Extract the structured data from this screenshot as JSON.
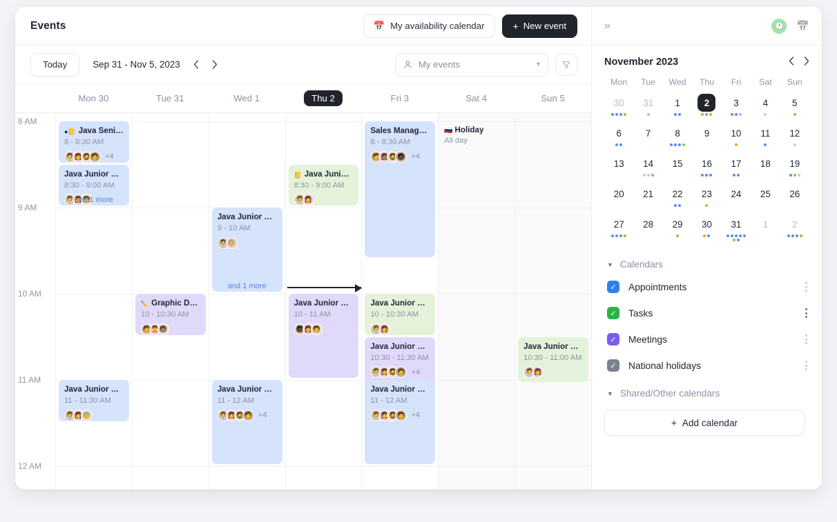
{
  "header": {
    "title": "Events",
    "availability_button": "My availability calendar",
    "availability_icon": "calendar-pencil-icon",
    "new_event_button": "New event",
    "new_event_plus": "+"
  },
  "toolbar": {
    "today_button": "Today",
    "range_label": "Sep 31 -  Nov 5, 2023",
    "prev_icon": "chevron-left-icon",
    "next_icon": "chevron-right-icon",
    "events_filter": "My events",
    "events_filter_icon": "person-icon",
    "caret_icon": "chevron-down-icon",
    "filter_icon": "funnel-icon"
  },
  "calendar": {
    "day_headers": [
      {
        "label": "Mon 30",
        "today": false,
        "weekend": false
      },
      {
        "label": "Tue 31",
        "today": false,
        "weekend": false
      },
      {
        "label": "Wed 1",
        "today": false,
        "weekend": false
      },
      {
        "label": "Thu 2",
        "today": true,
        "weekend": false
      },
      {
        "label": "Fri 3",
        "today": false,
        "weekend": false
      },
      {
        "label": "Sat 4",
        "today": false,
        "weekend": true
      },
      {
        "label": "Sun 5",
        "today": false,
        "weekend": true
      }
    ],
    "hours": [
      "8 AM",
      "9 AM",
      "10 AM",
      "11 AM",
      "12 AM"
    ],
    "more_label": "and 1 more",
    "events": [
      {
        "day": 0,
        "title": "Java Senio...",
        "time": "8 - 8:30 AM",
        "color": "blue",
        "start": 8.0,
        "end": 8.5,
        "avatars": [
          "🧑‍💼",
          "👩",
          "🧔",
          "🧑"
        ],
        "overflow": "+4",
        "badges": [
          "●",
          "📒"
        ],
        "more": false
      },
      {
        "day": 0,
        "title": "Java Junior dev...",
        "time": "8:30 - 9:00 AM",
        "color": "blue",
        "start": 8.5,
        "end": 9.0,
        "avatars": [
          "🧑‍💼",
          "👩",
          "🧑"
        ],
        "overflow": "",
        "badges": [],
        "more": true
      },
      {
        "day": 2,
        "title": "Java Junior dev...",
        "time": "9 - 10 AM",
        "color": "blue",
        "start": 9.0,
        "end": 10.0,
        "avatars": [
          "🧑‍💼",
          "🧓"
        ],
        "overflow": "",
        "badges": [],
        "more": true
      },
      {
        "day": 3,
        "title": "Java Junior d...",
        "time": "8:30 - 9:00 AM",
        "color": "green",
        "start": 8.5,
        "end": 9.0,
        "avatars": [
          "🧑‍💼",
          "👩"
        ],
        "overflow": "",
        "badges": [
          "📒"
        ],
        "more": false
      },
      {
        "day": 4,
        "title": "Sales Manager - Tatiana Patris",
        "time": "8 - 8:30 AM",
        "color": "blue",
        "start": 8.0,
        "end": 9.6,
        "avatars": [
          "🧑",
          "👩🏽",
          "🧔",
          "🧑🏿"
        ],
        "overflow": "+4",
        "badges": [],
        "more": false
      },
      {
        "day": 1,
        "title": "Graphic Des...",
        "time": "10 - 10:30 AM",
        "color": "lilac",
        "start": 10.0,
        "end": 10.5,
        "avatars": [
          "🧑",
          "🧑‍🦱",
          "🧑🏽"
        ],
        "overflow": "",
        "badges": [
          "✏️"
        ],
        "more": false
      },
      {
        "day": 3,
        "title": "Java Junior dev...",
        "time": "10 - 11 AM",
        "color": "lilac",
        "start": 10.0,
        "end": 11.0,
        "avatars": [
          "🧑🏿",
          "👩",
          "🧑"
        ],
        "overflow": "",
        "badges": [],
        "more": false
      },
      {
        "day": 4,
        "title": "Java Junior dev...",
        "time": "10 - 10:30 AM",
        "color": "green",
        "start": 10.0,
        "end": 10.5,
        "avatars": [
          "🧑‍💼",
          "👩"
        ],
        "overflow": "",
        "badges": [],
        "more": false
      },
      {
        "day": 4,
        "title": "Java Junior dev...",
        "time": "10:30 - 11:30 AM",
        "color": "lilac",
        "start": 10.5,
        "end": 11.5,
        "avatars": [
          "🧑‍💼",
          "👩",
          "🧔",
          "🧑"
        ],
        "overflow": "+4",
        "badges": [],
        "more": false
      },
      {
        "day": 6,
        "title": "Java Junior dev...",
        "time": "10:30 - 11:00 AM",
        "color": "green",
        "start": 10.5,
        "end": 11.05,
        "avatars": [
          "🧑‍💼",
          "👩"
        ],
        "overflow": "",
        "badges": [],
        "more": false
      },
      {
        "day": 0,
        "title": "Java Junior dev...",
        "time": "11 - 11:30 AM",
        "color": "blue",
        "start": 11.0,
        "end": 11.5,
        "avatars": [
          "🧑‍💼",
          "👩",
          "🧓"
        ],
        "overflow": "",
        "badges": [],
        "more": false
      },
      {
        "day": 2,
        "title": "Java Junior dev...",
        "time": "11 - 12 AM",
        "color": "blue",
        "start": 11.0,
        "end": 12.0,
        "avatars": [
          "🧑‍💼",
          "👩",
          "🧔",
          "🧑"
        ],
        "overflow": "+4",
        "badges": [],
        "more": false
      },
      {
        "day": 4,
        "title": "Java Junior dev...",
        "time": "11 - 12 AM",
        "color": "blue",
        "start": 11.0,
        "end": 12.0,
        "avatars": [
          "🧑‍💼",
          "👩",
          "🧔",
          "🧑"
        ],
        "overflow": "+4",
        "badges": [],
        "more": false
      }
    ],
    "allday": [
      {
        "day": 5,
        "title": "Holiday",
        "time": "All day",
        "flag": "🇷🇺"
      }
    ]
  },
  "sidebar": {
    "collapse_icon": "chevron-double-right-icon",
    "clock_icon": "clock-icon",
    "calendar_icon": "calendar-icon",
    "mini": {
      "title": "November 2023",
      "prev_icon": "chevron-left-icon",
      "next_icon": "chevron-right-icon",
      "dow": [
        "Mon",
        "Tue",
        "Wed",
        "Thu",
        "Fri",
        "Sat",
        "Sun"
      ],
      "days": [
        {
          "n": "30",
          "muted": true,
          "sel": false,
          "dots": [
            "#5b8def",
            "#5b8def",
            "#5b8def",
            "#8bc34a"
          ]
        },
        {
          "n": "31",
          "muted": true,
          "sel": false,
          "dots": [
            "#aab6f5"
          ]
        },
        {
          "n": "1",
          "muted": false,
          "sel": false,
          "dots": [
            "#5b8def",
            "#5b8def"
          ]
        },
        {
          "n": "2",
          "muted": false,
          "sel": true,
          "dots": [
            "#8bc34a",
            "#9e9e9e",
            "#f5a623"
          ]
        },
        {
          "n": "3",
          "muted": false,
          "sel": false,
          "dots": [
            "#5b8def",
            "#5b8def",
            "#aab6f5"
          ]
        },
        {
          "n": "4",
          "muted": false,
          "sel": false,
          "dots": [
            "#c9ccd6"
          ]
        },
        {
          "n": "5",
          "muted": false,
          "sel": false,
          "dots": [
            "#8bc34a"
          ]
        },
        {
          "n": "6",
          "muted": false,
          "sel": false,
          "dots": [
            "#5b8def",
            "#5b8def"
          ]
        },
        {
          "n": "7",
          "muted": false,
          "sel": false,
          "dots": []
        },
        {
          "n": "8",
          "muted": false,
          "sel": false,
          "dots": [
            "#5b8def",
            "#5b8def",
            "#5b8def",
            "#8bc34a"
          ]
        },
        {
          "n": "9",
          "muted": false,
          "sel": false,
          "dots": []
        },
        {
          "n": "10",
          "muted": false,
          "sel": false,
          "dots": [
            "#f5a623"
          ]
        },
        {
          "n": "11",
          "muted": false,
          "sel": false,
          "dots": [
            "#5b8def"
          ]
        },
        {
          "n": "12",
          "muted": false,
          "sel": false,
          "dots": [
            "#c9ccd6"
          ]
        },
        {
          "n": "13",
          "muted": false,
          "sel": false,
          "dots": []
        },
        {
          "n": "14",
          "muted": false,
          "sel": false,
          "dots": [
            "#c9ccd6",
            "#c9ccd6",
            "#8bc34a"
          ]
        },
        {
          "n": "15",
          "muted": false,
          "sel": false,
          "dots": []
        },
        {
          "n": "16",
          "muted": false,
          "sel": false,
          "dots": [
            "#5b8def",
            "#5b8def",
            "#5b8def"
          ]
        },
        {
          "n": "17",
          "muted": false,
          "sel": false,
          "dots": [
            "#5b8def",
            "#5b8def"
          ]
        },
        {
          "n": "18",
          "muted": false,
          "sel": false,
          "dots": []
        },
        {
          "n": "19",
          "muted": false,
          "sel": false,
          "dots": [
            "#5b8def",
            "#8bc34a",
            "#c9ccd6"
          ]
        },
        {
          "n": "20",
          "muted": false,
          "sel": false,
          "dots": []
        },
        {
          "n": "21",
          "muted": false,
          "sel": false,
          "dots": []
        },
        {
          "n": "22",
          "muted": false,
          "sel": false,
          "dots": [
            "#5b8def",
            "#5b8def"
          ]
        },
        {
          "n": "23",
          "muted": false,
          "sel": false,
          "dots": [
            "#f5a623"
          ]
        },
        {
          "n": "24",
          "muted": false,
          "sel": false,
          "dots": []
        },
        {
          "n": "25",
          "muted": false,
          "sel": false,
          "dots": []
        },
        {
          "n": "26",
          "muted": false,
          "sel": false,
          "dots": []
        },
        {
          "n": "27",
          "muted": false,
          "sel": false,
          "dots": [
            "#5b8def",
            "#5b8def",
            "#5b8def",
            "#8bc34a"
          ]
        },
        {
          "n": "28",
          "muted": false,
          "sel": false,
          "dots": []
        },
        {
          "n": "29",
          "muted": false,
          "sel": false,
          "dots": [
            "#8bc34a"
          ]
        },
        {
          "n": "30",
          "muted": false,
          "sel": false,
          "dots": [
            "#f5a623",
            "#5b8def"
          ]
        },
        {
          "n": "31",
          "muted": false,
          "sel": false,
          "dots": [
            "#5b8def",
            "#5b8def",
            "#5b8def",
            "#5b8def",
            "#5b8def",
            "#8bc34a",
            "#5b8def"
          ]
        },
        {
          "n": "1",
          "muted": true,
          "sel": false,
          "dots": []
        },
        {
          "n": "2",
          "muted": true,
          "sel": false,
          "dots": [
            "#5b8def",
            "#5b8def",
            "#5b8def",
            "#8bc34a"
          ]
        }
      ]
    },
    "calendars_section": {
      "label": "Calendars",
      "triangle_icon": "triangle-down-icon",
      "items": [
        {
          "label": "Appointments",
          "color": "#2f80ed",
          "checked": true,
          "kebab_dark": false
        },
        {
          "label": "Tasks",
          "color": "#28b446",
          "checked": true,
          "kebab_dark": true
        },
        {
          "label": "Meetings",
          "color": "#7b5cf0",
          "checked": true,
          "kebab_dark": false
        },
        {
          "label": "National holidays",
          "color": "#7b8191",
          "checked": true,
          "kebab_dark": false
        }
      ]
    },
    "shared_section": {
      "label": "Shared/Other calendars",
      "triangle_icon": "triangle-down-icon"
    },
    "add_calendar_button": "Add calendar",
    "add_calendar_plus": "+"
  }
}
